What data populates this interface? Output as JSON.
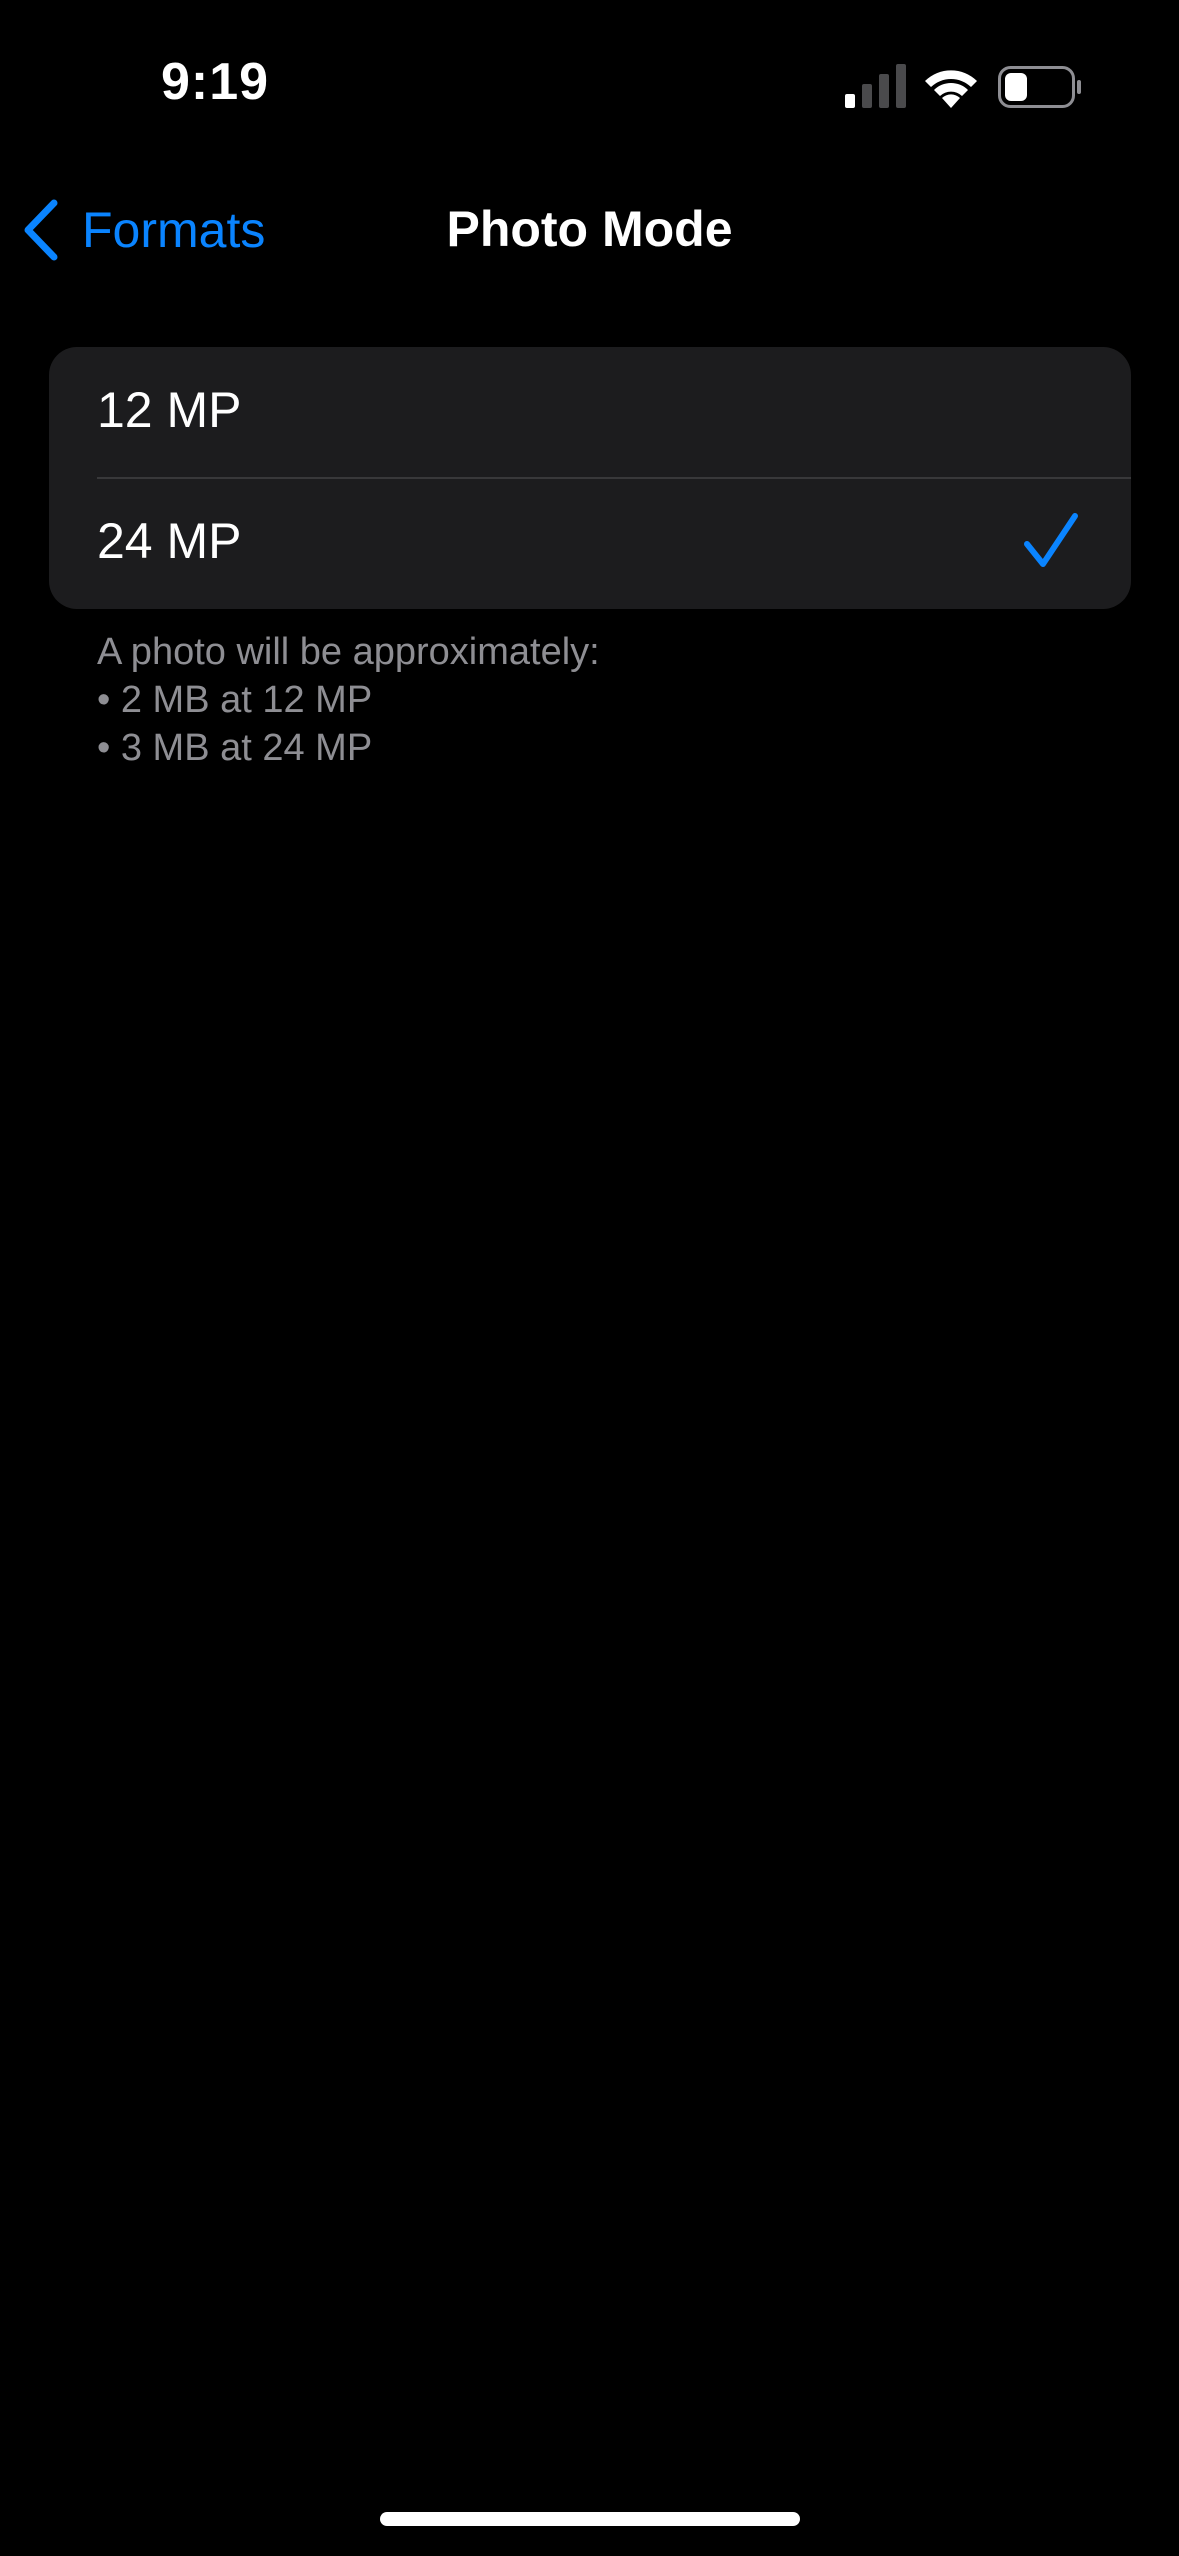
{
  "status_bar": {
    "time": "9:19",
    "signal_icon": "cellular-signal-icon",
    "wifi_icon": "wifi-icon",
    "battery_icon": "battery-icon"
  },
  "nav": {
    "back_label": "Formats",
    "back_icon": "chevron-left-icon",
    "title": "Photo Mode"
  },
  "options": [
    {
      "label": "12 MP",
      "selected": false
    },
    {
      "label": "24 MP",
      "selected": true
    }
  ],
  "footer": {
    "intro": "A photo will be approximately:",
    "lines": [
      "• 2 MB at 12 MP",
      "• 3 MB at 24 MP"
    ]
  },
  "colors": {
    "accent": "#0a84ff",
    "background": "#000000",
    "group_background": "#1c1c1e",
    "secondary_text": "#8e8e93",
    "separator": "#38383a"
  }
}
